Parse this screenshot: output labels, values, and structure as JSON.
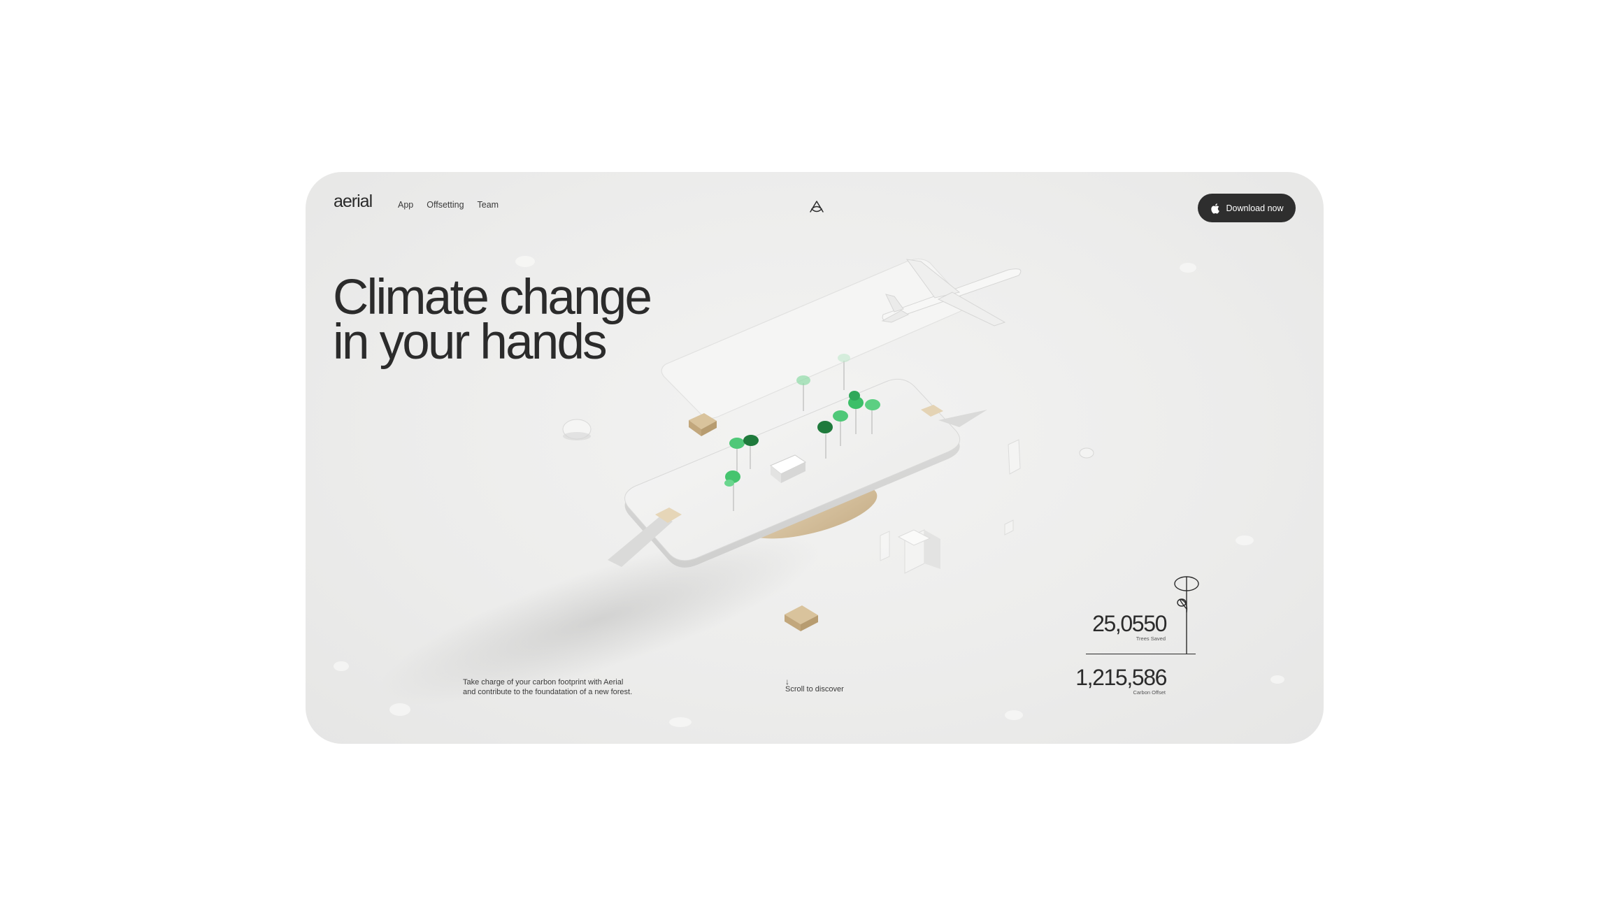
{
  "brand": {
    "logo": "aerial",
    "center_icon": "aerial-mark-icon"
  },
  "nav": {
    "items": [
      {
        "label": "App"
      },
      {
        "label": "Offsetting"
      },
      {
        "label": "Team"
      }
    ]
  },
  "cta": {
    "label": "Download now",
    "icon": "apple-icon"
  },
  "hero": {
    "line1": "Climate change",
    "line2": "in your hands"
  },
  "tagline": {
    "line1": "Take charge of your carbon footprint with Aerial",
    "line2": "and contribute to the foundatation of a new forest."
  },
  "scroll": {
    "arrow": "↓",
    "label": "Scroll to discover"
  },
  "stats": {
    "trees": {
      "value": "25,0550",
      "label": "Trees Saved"
    },
    "carbon": {
      "value": "1,215,586",
      "label": "Carbon Offset"
    }
  },
  "colors": {
    "card_bg": "#ececeb",
    "button_bg": "#2e2e2e",
    "text": "#2b2b2b",
    "tree_green": "#3fbf66",
    "tree_dark": "#1f7a3c",
    "wood": "#d8c4a0"
  }
}
